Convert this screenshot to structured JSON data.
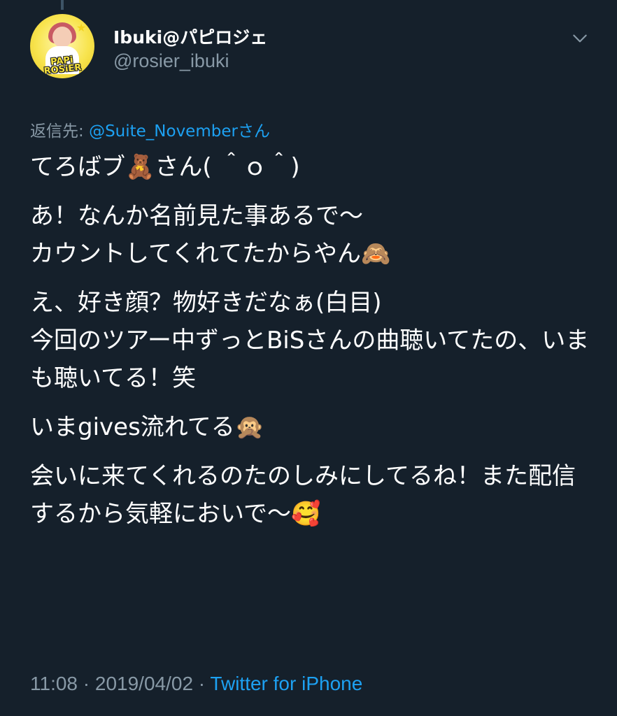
{
  "tweet": {
    "author": {
      "display_name": "Ibuki@パピロジェ",
      "handle": "@rosier_ibuki",
      "avatar_logo": "PAPi ROSiER"
    },
    "reply_label": "返信先:",
    "reply_mention": "@Suite_November",
    "reply_suffix": "さん",
    "paragraphs": [
      "てろばブ🧸さん( ＾ｏ＾)",
      "あ！なんか名前見た事あるで〜\nカウントしてくれてたからやん🙈",
      "え、好き顔？物好きだなぁ(白目)\n今回のツアー中ずっとBiSさんの曲聴いてたの、いまも聴いてる！笑",
      "いまgives流れてる🙊",
      "会いに来てくれるのたのしみにしてるね！また配信するから気軽においで〜🥰"
    ],
    "time": "11:08",
    "separator": " · ",
    "date": "2019/04/02",
    "source": "Twitter for iPhone"
  },
  "icons": {
    "menu": "chevron-down-icon"
  },
  "colors": {
    "background": "#15202b",
    "text": "#ffffff",
    "secondary": "#8899a6",
    "link": "#1da1f2"
  }
}
